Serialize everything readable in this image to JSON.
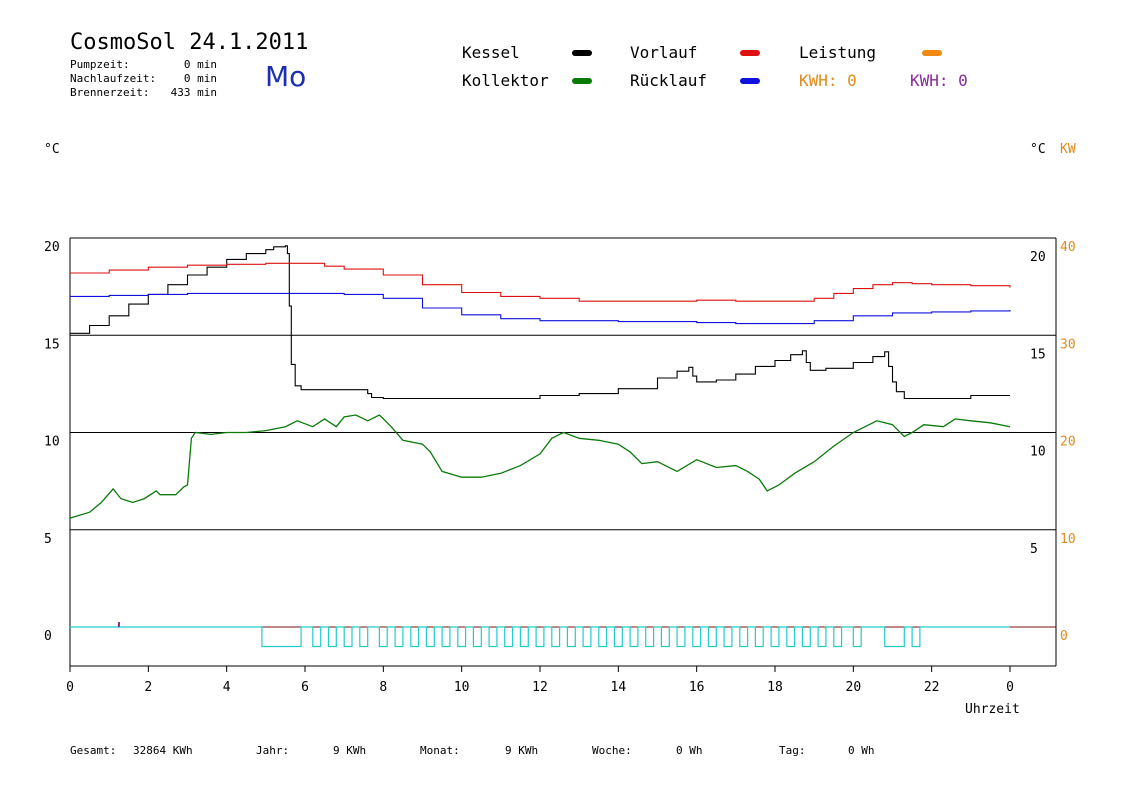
{
  "header": {
    "title": "CosmoSol 24.1.2011",
    "weekday": "Mo",
    "pump_label": "Pumpzeit:",
    "pump_value": "0 min",
    "overrun_label": "Nachlaufzeit:",
    "overrun_value": "0 min",
    "burner_label": "Brennerzeit:",
    "burner_value": "433 min"
  },
  "legend": {
    "kessel": "Kessel",
    "kollektor": "Kollektor",
    "vorlauf": "Vorlauf",
    "ruecklauf": "Rücklauf",
    "leistung": "Leistung",
    "kwh_orange": "KWH: 0",
    "kwh_purple": "KWH: 0"
  },
  "colors": {
    "kessel": "#000000",
    "kollektor": "#0a7a0a",
    "vorlauf": "#dd1111",
    "ruecklauf": "#1111dd",
    "leistung": "#f08a12",
    "kwh_orange": "#e08a1c",
    "kwh_purple": "#8a2a9a",
    "pump": "#22cccc",
    "grid": "#000000"
  },
  "axes": {
    "left_unit": "°C",
    "right_unit": "°C",
    "right_unit2": "KW",
    "xlabel": "Uhrzeit"
  },
  "footer": {
    "gesamt_label": "Gesamt:",
    "gesamt_value": "32864 KWh",
    "jahr_label": "Jahr:",
    "jahr_value": "9 KWh",
    "monat_label": "Monat:",
    "monat_value": "9 KWh",
    "woche_label": "Woche:",
    "woche_value": "0 Wh",
    "tag_label": "Tag:",
    "tag_value": "0 Wh"
  },
  "chart_data": {
    "type": "line",
    "xlim": [
      0,
      24
    ],
    "ylim": [
      0,
      20
    ],
    "x_ticks": [
      0,
      2,
      4,
      6,
      8,
      10,
      12,
      14,
      16,
      18,
      20,
      22,
      24
    ],
    "x_tick_labels": [
      "0",
      "2",
      "4",
      "6",
      "8",
      "10",
      "12",
      "14",
      "16",
      "18",
      "20",
      "22",
      "0"
    ],
    "y_left_ticks": [
      0,
      5,
      10,
      15,
      20
    ],
    "y_right_inner_ticks": [
      5,
      10,
      15,
      20
    ],
    "y_right_outer_ticks": [
      0,
      10,
      20,
      30,
      40
    ],
    "hgrid": [
      5,
      10,
      15,
      20
    ],
    "series": [
      {
        "key": "kessel",
        "points": [
          [
            0,
            15.1
          ],
          [
            0.5,
            15.5
          ],
          [
            1,
            16
          ],
          [
            1.5,
            16.6
          ],
          [
            2,
            17.1
          ],
          [
            2.5,
            17.6
          ],
          [
            3,
            18.1
          ],
          [
            3.5,
            18.5
          ],
          [
            4,
            18.9
          ],
          [
            4.5,
            19.2
          ],
          [
            5,
            19.4
          ],
          [
            5.2,
            19.55
          ],
          [
            5.5,
            19.6
          ],
          [
            5.55,
            19.2
          ],
          [
            5.6,
            16.5
          ],
          [
            5.65,
            13.5
          ],
          [
            5.75,
            12.4
          ],
          [
            5.9,
            12.2
          ],
          [
            6.5,
            12.2
          ],
          [
            7.5,
            12.2
          ],
          [
            7.6,
            12.0
          ],
          [
            7.7,
            11.8
          ],
          [
            8,
            11.75
          ],
          [
            9,
            11.75
          ],
          [
            10,
            11.75
          ],
          [
            11,
            11.75
          ],
          [
            12,
            11.9
          ],
          [
            13,
            12.0
          ],
          [
            14,
            12.25
          ],
          [
            15,
            12.8
          ],
          [
            15.5,
            13.15
          ],
          [
            15.8,
            13.35
          ],
          [
            15.9,
            12.9
          ],
          [
            16,
            12.6
          ],
          [
            16.5,
            12.7
          ],
          [
            17,
            13.0
          ],
          [
            17.5,
            13.4
          ],
          [
            18,
            13.7
          ],
          [
            18.4,
            14.0
          ],
          [
            18.7,
            14.2
          ],
          [
            18.8,
            13.6
          ],
          [
            18.9,
            13.2
          ],
          [
            19.3,
            13.3
          ],
          [
            20,
            13.6
          ],
          [
            20.5,
            13.9
          ],
          [
            20.8,
            14.15
          ],
          [
            20.9,
            13.4
          ],
          [
            21,
            12.6
          ],
          [
            21.1,
            12.1
          ],
          [
            21.3,
            11.75
          ],
          [
            22,
            11.75
          ],
          [
            23,
            11.9
          ],
          [
            24,
            11.9
          ]
        ]
      },
      {
        "key": "vorlauf",
        "points": [
          [
            0,
            18.2
          ],
          [
            1,
            18.35
          ],
          [
            2,
            18.5
          ],
          [
            3,
            18.6
          ],
          [
            4,
            18.65
          ],
          [
            5,
            18.7
          ],
          [
            6,
            18.7
          ],
          [
            6.5,
            18.55
          ],
          [
            7,
            18.4
          ],
          [
            8,
            18.1
          ],
          [
            9,
            17.6
          ],
          [
            10,
            17.2
          ],
          [
            11,
            17.0
          ],
          [
            12,
            16.9
          ],
          [
            13,
            16.75
          ],
          [
            14,
            16.75
          ],
          [
            15,
            16.75
          ],
          [
            16,
            16.8
          ],
          [
            17,
            16.75
          ],
          [
            18,
            16.75
          ],
          [
            19,
            16.9
          ],
          [
            19.5,
            17.15
          ],
          [
            20,
            17.4
          ],
          [
            20.5,
            17.6
          ],
          [
            21,
            17.7
          ],
          [
            21.5,
            17.65
          ],
          [
            22,
            17.6
          ],
          [
            23,
            17.55
          ],
          [
            24,
            17.45
          ]
        ]
      },
      {
        "key": "ruecklauf",
        "points": [
          [
            0,
            17.0
          ],
          [
            1,
            17.05
          ],
          [
            2,
            17.1
          ],
          [
            3,
            17.15
          ],
          [
            4,
            17.15
          ],
          [
            5,
            17.15
          ],
          [
            6,
            17.15
          ],
          [
            7,
            17.1
          ],
          [
            8,
            16.9
          ],
          [
            9,
            16.4
          ],
          [
            10,
            16.05
          ],
          [
            11,
            15.85
          ],
          [
            12,
            15.75
          ],
          [
            13,
            15.75
          ],
          [
            14,
            15.7
          ],
          [
            15,
            15.7
          ],
          [
            16,
            15.65
          ],
          [
            17,
            15.6
          ],
          [
            18,
            15.6
          ],
          [
            19,
            15.75
          ],
          [
            20,
            16.0
          ],
          [
            21,
            16.15
          ],
          [
            22,
            16.2
          ],
          [
            23,
            16.25
          ],
          [
            24,
            16.3
          ]
        ]
      },
      {
        "key": "kollektor",
        "points": [
          [
            0,
            5.6
          ],
          [
            0.5,
            5.9
          ],
          [
            0.8,
            6.4
          ],
          [
            1.1,
            7.1
          ],
          [
            1.3,
            6.6
          ],
          [
            1.6,
            6.4
          ],
          [
            1.9,
            6.6
          ],
          [
            2.2,
            7.0
          ],
          [
            2.3,
            6.8
          ],
          [
            2.7,
            6.8
          ],
          [
            2.9,
            7.2
          ],
          [
            3.0,
            7.3
          ],
          [
            3.1,
            9.7
          ],
          [
            3.2,
            10.0
          ],
          [
            3.6,
            9.9
          ],
          [
            4.0,
            10.0
          ],
          [
            4.5,
            10.0
          ],
          [
            5.0,
            10.1
          ],
          [
            5.5,
            10.3
          ],
          [
            5.8,
            10.6
          ],
          [
            6.2,
            10.3
          ],
          [
            6.5,
            10.7
          ],
          [
            6.8,
            10.3
          ],
          [
            7.0,
            10.8
          ],
          [
            7.3,
            10.9
          ],
          [
            7.6,
            10.6
          ],
          [
            7.9,
            10.9
          ],
          [
            8.2,
            10.3
          ],
          [
            8.5,
            9.6
          ],
          [
            9.0,
            9.4
          ],
          [
            9.2,
            9.0
          ],
          [
            9.5,
            8.0
          ],
          [
            10,
            7.7
          ],
          [
            10.5,
            7.7
          ],
          [
            11,
            7.9
          ],
          [
            11.5,
            8.3
          ],
          [
            12,
            8.9
          ],
          [
            12.3,
            9.7
          ],
          [
            12.6,
            10.0
          ],
          [
            13,
            9.7
          ],
          [
            13.5,
            9.6
          ],
          [
            14,
            9.4
          ],
          [
            14.3,
            9.0
          ],
          [
            14.6,
            8.4
          ],
          [
            15,
            8.5
          ],
          [
            15.5,
            8.0
          ],
          [
            16,
            8.6
          ],
          [
            16.5,
            8.2
          ],
          [
            17,
            8.3
          ],
          [
            17.3,
            8.0
          ],
          [
            17.6,
            7.6
          ],
          [
            17.8,
            7.0
          ],
          [
            18.1,
            7.3
          ],
          [
            18.5,
            7.9
          ],
          [
            19,
            8.5
          ],
          [
            19.5,
            9.3
          ],
          [
            20,
            10.0
          ],
          [
            20.3,
            10.3
          ],
          [
            20.6,
            10.6
          ],
          [
            21,
            10.4
          ],
          [
            21.3,
            9.8
          ],
          [
            21.5,
            10.0
          ],
          [
            21.8,
            10.4
          ],
          [
            22.3,
            10.3
          ],
          [
            22.6,
            10.7
          ],
          [
            23,
            10.6
          ],
          [
            23.5,
            10.5
          ],
          [
            24,
            10.3
          ]
        ]
      }
    ],
    "pump_pulses": [
      [
        4.9,
        5.9
      ],
      [
        6.2,
        6.4
      ],
      [
        6.6,
        6.8
      ],
      [
        7.0,
        7.2
      ],
      [
        7.4,
        7.6
      ],
      [
        7.9,
        8.1
      ],
      [
        8.3,
        8.5
      ],
      [
        8.7,
        8.9
      ],
      [
        9.1,
        9.3
      ],
      [
        9.5,
        9.7
      ],
      [
        9.9,
        10.1
      ],
      [
        10.3,
        10.5
      ],
      [
        10.7,
        10.9
      ],
      [
        11.1,
        11.3
      ],
      [
        11.5,
        11.7
      ],
      [
        11.9,
        12.1
      ],
      [
        12.3,
        12.5
      ],
      [
        12.7,
        12.9
      ],
      [
        13.1,
        13.3
      ],
      [
        13.5,
        13.7
      ],
      [
        13.9,
        14.1
      ],
      [
        14.3,
        14.5
      ],
      [
        14.7,
        14.9
      ],
      [
        15.1,
        15.3
      ],
      [
        15.5,
        15.7
      ],
      [
        15.9,
        16.1
      ],
      [
        16.3,
        16.5
      ],
      [
        16.7,
        16.9
      ],
      [
        17.1,
        17.3
      ],
      [
        17.5,
        17.7
      ],
      [
        17.9,
        18.1
      ],
      [
        18.3,
        18.5
      ],
      [
        18.7,
        18.9
      ],
      [
        19.1,
        19.3
      ],
      [
        19.5,
        19.7
      ],
      [
        20.0,
        20.2
      ],
      [
        20.8,
        21.3
      ],
      [
        21.5,
        21.7
      ]
    ],
    "pump_high": 0,
    "pump_low": -1
  }
}
